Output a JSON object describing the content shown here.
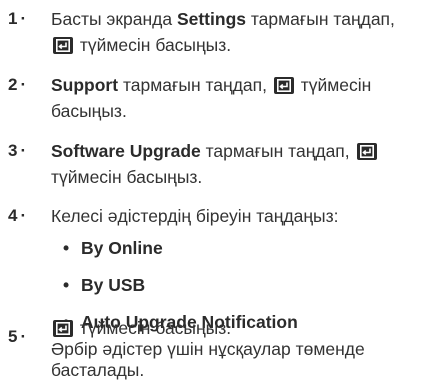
{
  "steps": [
    {
      "number": "1",
      "line1_a": "Басты экранда ",
      "line1_b": "Settings",
      "line1_c": " тармағын таңдап,",
      "line2_b": " түймесін басыңыз."
    },
    {
      "number": "2",
      "line1_a": "Support",
      "line1_b": " тармағын таңдап, ",
      "line1_c": " түймесін",
      "line2": "басыңыз."
    },
    {
      "number": "3",
      "line1_a": "Software Upgrade",
      "line1_b": " тармағын таңдап, ",
      "line2": "түймесін басыңыз."
    },
    {
      "number": "4",
      "line1": "Келесі әдістердің біреуін таңдаңыз:",
      "options": [
        "By Online",
        "By USB",
        "Auto Upgrade Notification"
      ]
    },
    {
      "number": "5",
      "line1_b": " түймесін басыңыз.",
      "line2": "Әрбір әдістер үшін нұсқаулар төменде",
      "line3": "басталады."
    }
  ],
  "step_separator": "·",
  "bullet_char": "•",
  "icons": {
    "enter": "enter-button-icon"
  },
  "colors": {
    "text": "#333333",
    "bold_text": "#2b2b2b",
    "icon_bg": "#2b2b2b"
  }
}
